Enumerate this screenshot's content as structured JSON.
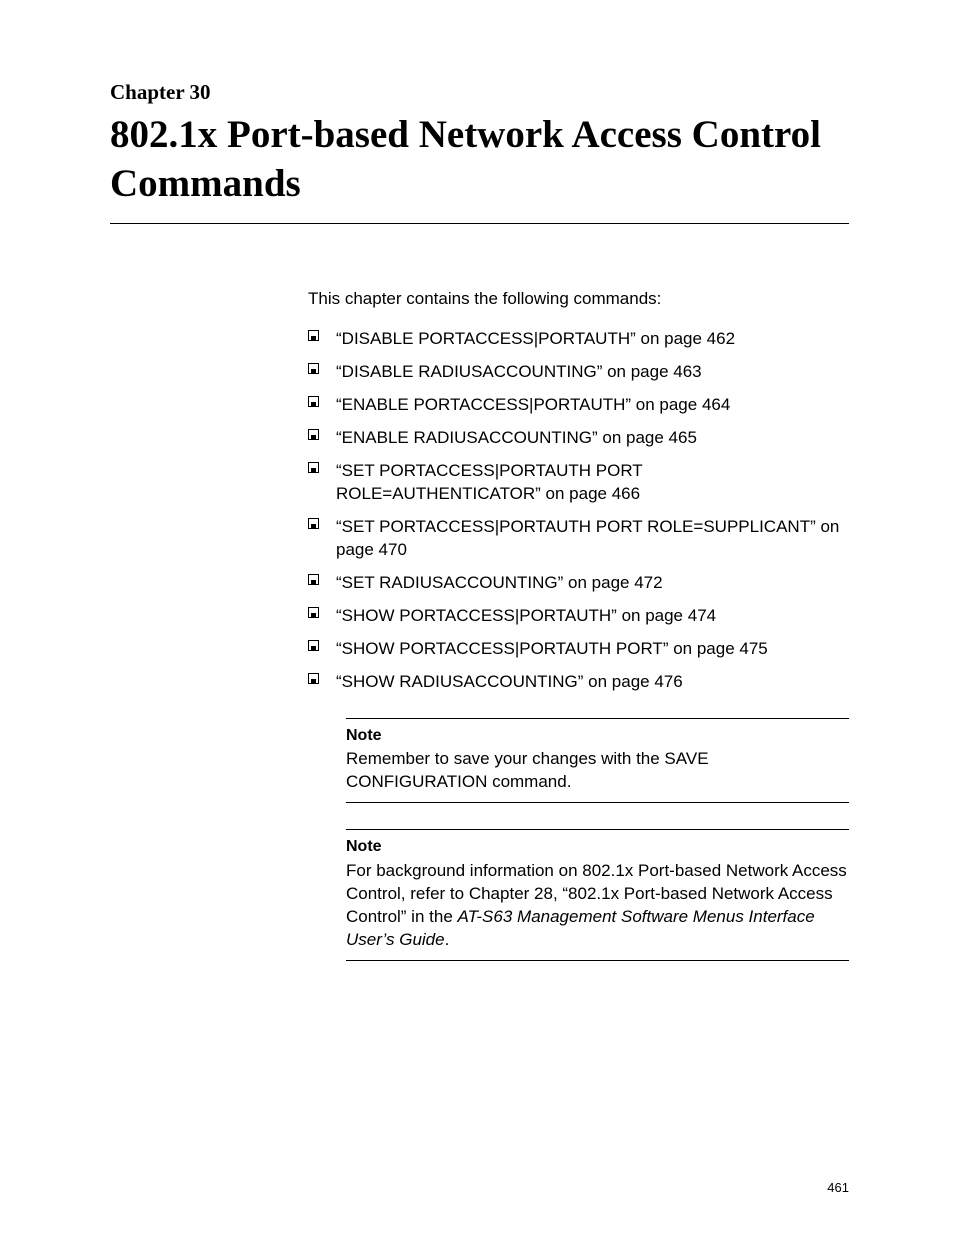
{
  "chapter": {
    "label": "Chapter 30",
    "title": "802.1x Port-based Network Access Control Commands"
  },
  "intro": "This chapter contains the following commands:",
  "commands": [
    "“DISABLE PORTACCESS|PORTAUTH” on page 462",
    "“DISABLE RADIUSACCOUNTING” on page 463",
    "“ENABLE PORTACCESS|PORTAUTH” on page 464",
    "“ENABLE RADIUSACCOUNTING” on page 465",
    "“SET PORTACCESS|PORTAUTH PORT ROLE=AUTHENTICATOR” on page 466",
    "“SET PORTACCESS|PORTAUTH PORT ROLE=SUPPLICANT” on page 470",
    "“SET RADIUSACCOUNTING” on page 472",
    "“SHOW PORTACCESS|PORTAUTH” on page 474",
    "“SHOW PORTACCESS|PORTAUTH PORT” on page 475",
    "“SHOW RADIUSACCOUNTING” on page 476"
  ],
  "notes": [
    {
      "label": "Note",
      "body_plain": "Remember to save your changes with the SAVE CONFIGURATION command.",
      "body_ital": ""
    },
    {
      "label": "Note",
      "body_plain": "For background information on 802.1x Port-based Network Access Control, refer to Chapter 28, “802.1x Port-based Network Access Control” in the ",
      "body_ital": "AT-S63 Management Software Menus Interface User’s Guide",
      "body_tail": "."
    }
  ],
  "page_number": "461"
}
